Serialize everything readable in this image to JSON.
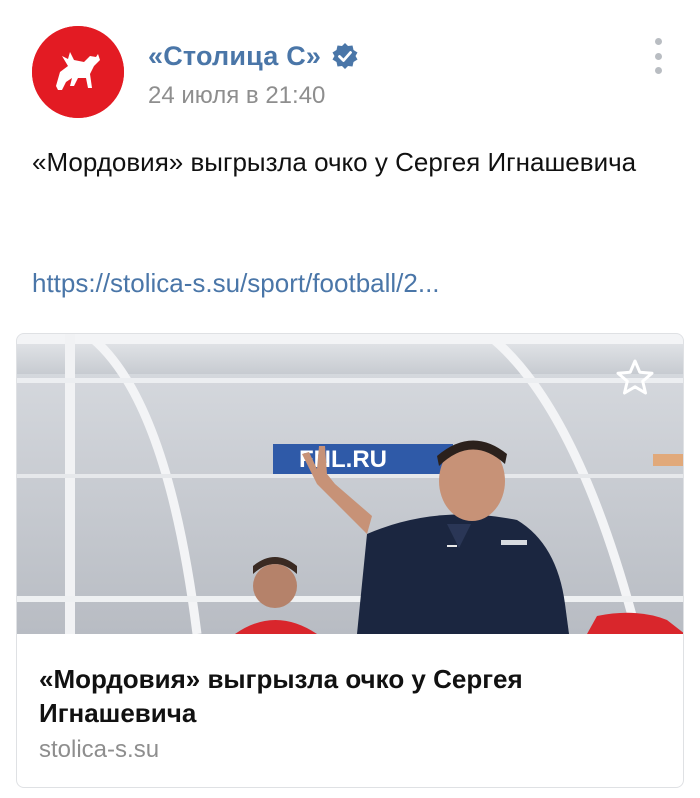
{
  "header": {
    "author": "«Столица С»",
    "date": "24 июля в 21:40",
    "avatar_icon": "fox-logo-icon",
    "verified_icon": "verified-check-icon",
    "menu_icon": "more-vertical-icon"
  },
  "post": {
    "text": "«Мордовия» выгрызла очко у Сергея Игнашевича",
    "link": "https://stolica-s.su/sport/football/2..."
  },
  "attachment": {
    "banner_text": "FNL.RU",
    "title": "«Мордовия» выгрызла очко у Сергея Игнашевича",
    "domain": "stolica-s.su",
    "favorite_icon": "star-outline-icon"
  },
  "colors": {
    "accent": "#4a76a8",
    "brand_red": "#e31b23",
    "muted": "#8e8e8e"
  }
}
